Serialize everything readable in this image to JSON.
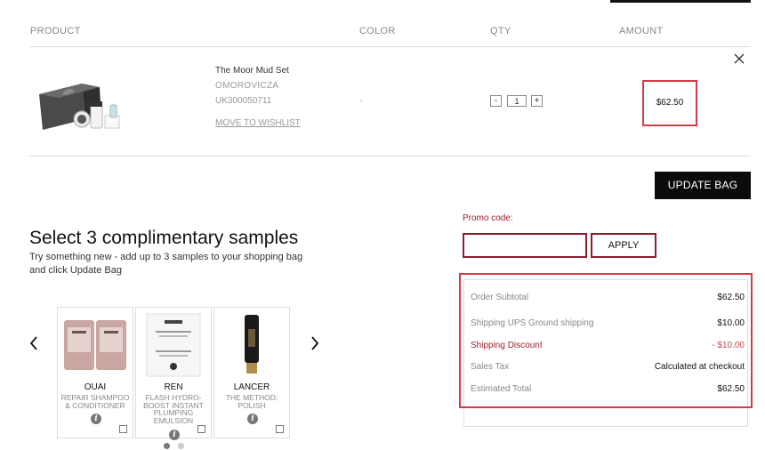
{
  "table": {
    "headers": {
      "product": "PRODUCT",
      "color": "COLOR",
      "qty": "QTY",
      "amount": "AMOUNT"
    }
  },
  "item": {
    "name": "The Moor Mud Set",
    "brand": "OMOROVICZA",
    "sku": "UK300050711",
    "wishlist_label": "MOVE TO WISHLIST",
    "color": "-",
    "qty": "1",
    "qty_minus": "-",
    "qty_plus": "+",
    "amount": "$62.50",
    "remove_icon": "close-icon"
  },
  "update_bag_label": "UPDATE BAG",
  "promo": {
    "label": "Promo code:",
    "placeholder": "",
    "apply_label": "APPLY"
  },
  "summary": {
    "subtotal_label": "Order Subtotal",
    "subtotal_value": "$62.50",
    "shipping_label": "Shipping UPS Ground shipping",
    "shipping_value": "$10.00",
    "discount_label": "Shipping Discount",
    "discount_value": "- $10.00",
    "tax_label": "Sales Tax",
    "tax_value": "Calculated at checkout",
    "total_label": "Estimated Total",
    "total_value": "$62.50"
  },
  "samples": {
    "title": "Select 3 complimentary samples",
    "subtitle": "Try something new - add up to 3 samples to your shopping bag and click Update Bag",
    "prev_icon": "chevron-left-icon",
    "next_icon": "chevron-right-icon",
    "items": [
      {
        "brand": "OUAI",
        "desc": "REPAIR SHAMPOO & CONDITIONER"
      },
      {
        "brand": "REN",
        "desc": "FLASH HYDRO-BOOST INSTANT PLUMPING EMULSION"
      },
      {
        "brand": "LANCER",
        "desc": "THE METHOD: POLISH"
      }
    ],
    "info_glyph": "i"
  },
  "colors": {
    "accent": "#8a1e32",
    "highlight": "#d83a44",
    "button_dark": "#0b0b0b"
  }
}
